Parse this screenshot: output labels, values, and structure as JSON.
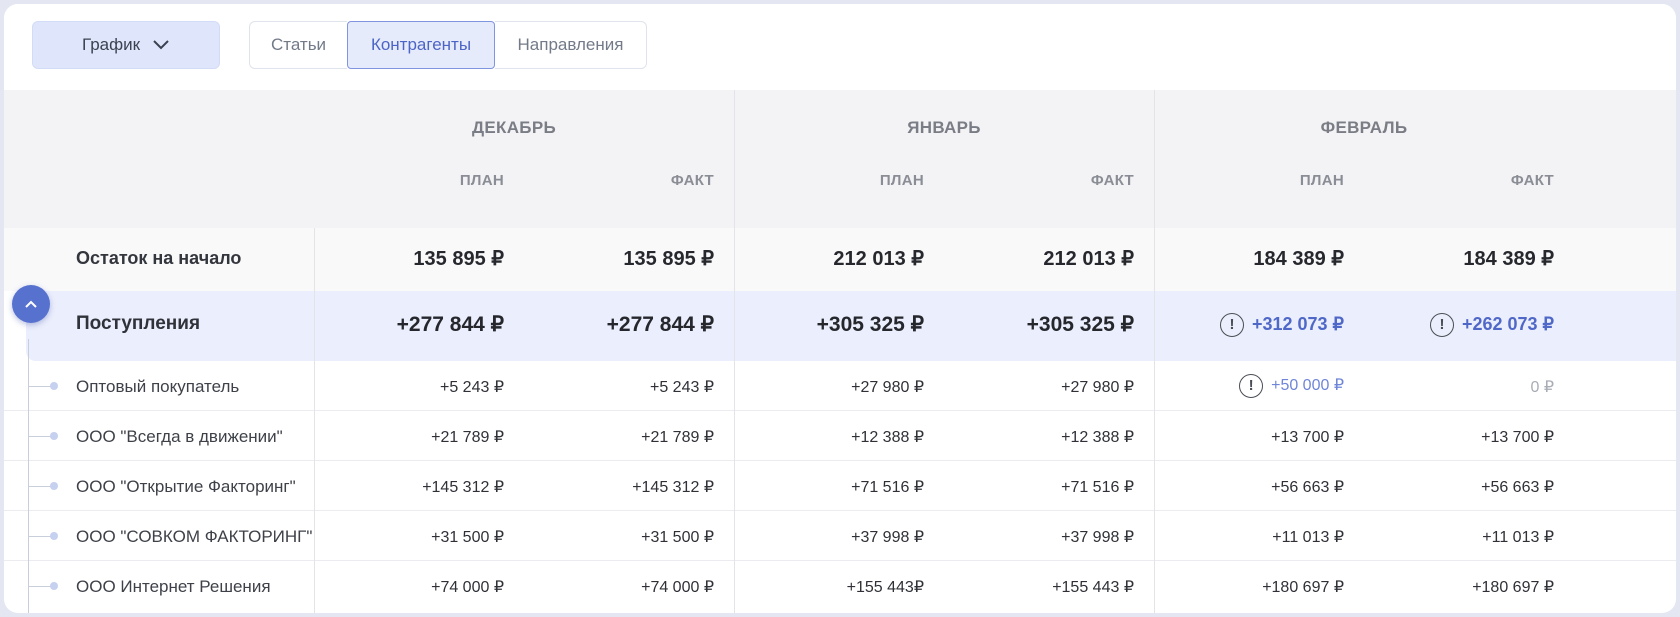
{
  "toolbar": {
    "chart_button_label": "График",
    "tabs": [
      {
        "label": "Статьи",
        "active": false
      },
      {
        "label": "Контрагенты",
        "active": true
      },
      {
        "label": "Направления",
        "active": false
      }
    ]
  },
  "table": {
    "months": [
      "ДЕКАБРЬ",
      "ЯНВАРЬ",
      "ФЕВРАЛЬ"
    ],
    "sub_headers": {
      "plan": "ПЛАН",
      "fact": "ФАКТ"
    },
    "opening_balance": {
      "label": "Остаток на начало",
      "values": [
        "135 895 ₽",
        "135 895 ₽",
        "212 013 ₽",
        "212 013 ₽",
        "184 389 ₽",
        "184 389 ₽"
      ]
    },
    "income": {
      "label": "Поступления",
      "values": [
        "+277 844 ₽",
        "+277 844 ₽",
        "+305 325 ₽",
        "+305 325 ₽",
        "+312 073 ₽",
        "+262 073 ₽"
      ]
    },
    "counterparties": [
      {
        "label": "Оптовый покупатель",
        "values": [
          "+5 243 ₽",
          "+5 243 ₽",
          "+27 980 ₽",
          "+27 980 ₽",
          "+50 000 ₽",
          "0 ₽"
        ]
      },
      {
        "label": "ООО \"Всегда в движении\"",
        "values": [
          "+21 789 ₽",
          "+21 789 ₽",
          "+12 388 ₽",
          "+12 388 ₽",
          "+13 700 ₽",
          "+13 700 ₽"
        ]
      },
      {
        "label": "ООО \"Открытие Факторинг\"",
        "values": [
          "+145 312 ₽",
          "+145 312 ₽",
          "+71 516 ₽",
          "+71 516 ₽",
          "+56 663 ₽",
          "+56 663 ₽"
        ]
      },
      {
        "label": "ООО \"СОВКОМ ФАКТОРИНГ\"",
        "values": [
          "+31 500 ₽",
          "+31 500 ₽",
          "+37 998 ₽",
          "+37 998 ₽",
          "+11 013 ₽",
          "+11 013 ₽"
        ]
      },
      {
        "label": "ООО Интернет Решения",
        "values": [
          "+74 000 ₽",
          "+74 000 ₽",
          "+155 443₽",
          "+155 443  ₽",
          "+180 697 ₽",
          "+180 697 ₽"
        ]
      }
    ]
  },
  "colors": {
    "accent": "#5771cf",
    "warning_text": "#4f68c8",
    "income_row_bg": "#ebeefc",
    "header_bg": "#f3f3f5"
  },
  "icons": {
    "chart_chevron": "chevron-down-icon",
    "collapse": "chevron-up-icon",
    "warning": "exclamation-circle-icon"
  }
}
